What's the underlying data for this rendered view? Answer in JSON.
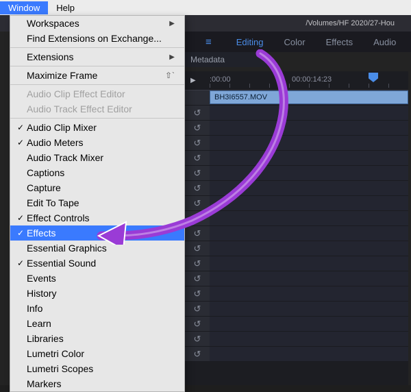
{
  "menubar": {
    "window": "Window",
    "help": "Help"
  },
  "dropdown": {
    "workspaces": "Workspaces",
    "find_ext": "Find Extensions on Exchange...",
    "extensions": "Extensions",
    "maximize": "Maximize Frame",
    "maximize_key": "⇧`",
    "audio_clip_eff": "Audio Clip Effect Editor",
    "audio_track_eff": "Audio Track Effect Editor",
    "items": [
      {
        "label": "Audio Clip Mixer",
        "checked": true
      },
      {
        "label": "Audio Meters",
        "checked": true
      },
      {
        "label": "Audio Track Mixer",
        "checked": false
      },
      {
        "label": "Captions",
        "checked": false
      },
      {
        "label": "Capture",
        "checked": false
      },
      {
        "label": "Edit To Tape",
        "checked": false
      },
      {
        "label": "Effect Controls",
        "checked": true
      },
      {
        "label": "Effects",
        "checked": true,
        "highlighted": true
      },
      {
        "label": "Essential Graphics",
        "checked": false
      },
      {
        "label": "Essential Sound",
        "checked": true
      },
      {
        "label": "Events",
        "checked": false
      },
      {
        "label": "History",
        "checked": false
      },
      {
        "label": "Info",
        "checked": false
      },
      {
        "label": "Learn",
        "checked": false
      },
      {
        "label": "Libraries",
        "checked": false
      },
      {
        "label": "Lumetri Color",
        "checked": false
      },
      {
        "label": "Lumetri Scopes",
        "checked": false
      },
      {
        "label": "Markers",
        "checked": false
      }
    ]
  },
  "topbar": {
    "path": "/Volumes/HF 2020/27-Hou"
  },
  "tabs": {
    "edit": "Editing",
    "color": "Color",
    "effects": "Effects",
    "audio": "Audio"
  },
  "subhdr": {
    "metadata": "Metadata"
  },
  "ruler": {
    "t0": ":00:00",
    "t1": "00:00:14:23"
  },
  "clip": {
    "name": "BH3I6557.MOV"
  },
  "icons": {
    "undo": "↺"
  }
}
